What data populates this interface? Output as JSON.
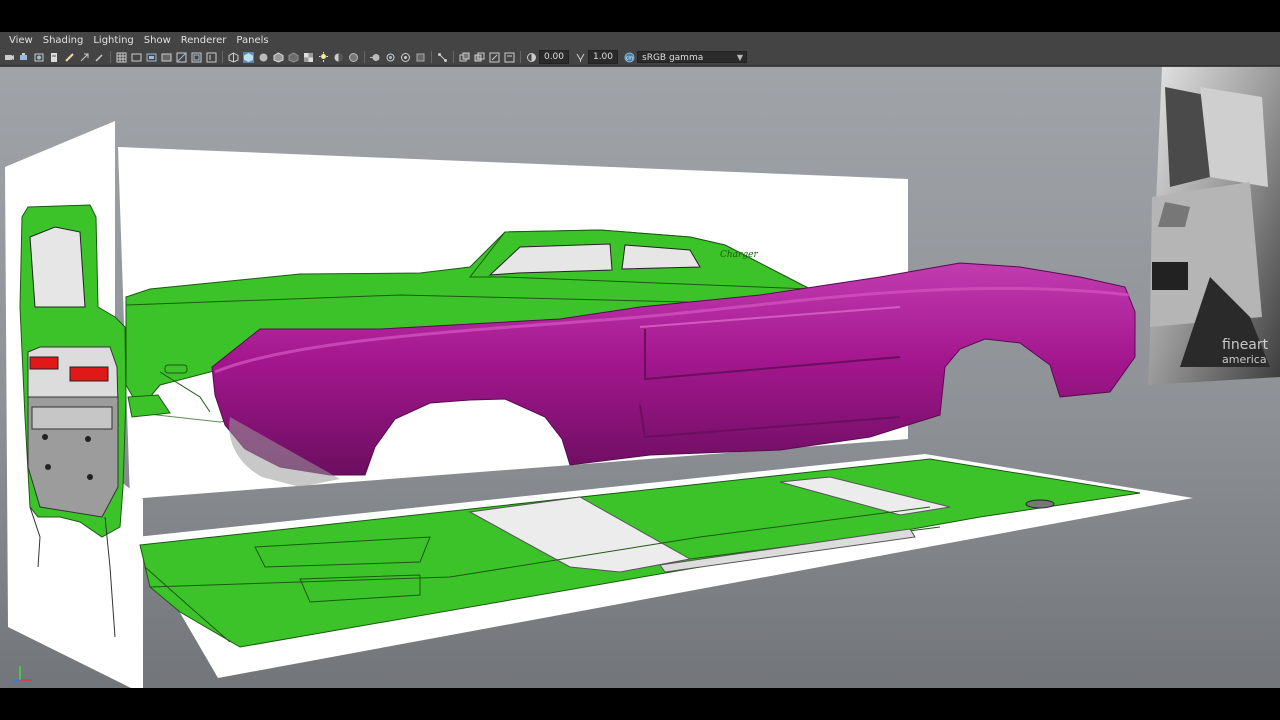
{
  "menu": {
    "items": [
      "View",
      "Shading",
      "Lighting",
      "Show",
      "Renderer",
      "Panels"
    ]
  },
  "toolbar": {
    "exposure_value": "0.00",
    "gamma_value": "1.00",
    "color_space": "sRGB gamma",
    "icons": [
      "camera-select-icon",
      "camera-attributes-icon",
      "bookmark-icon",
      "image-plane-icon",
      "grease-pencil-icon",
      "2d-pan-zoom-icon",
      "grid-icon",
      "film-gate-icon",
      "resolution-gate-icon",
      "gate-mask-icon",
      "field-chart-icon",
      "safe-action-icon",
      "safe-title-icon",
      "wireframe-icon",
      "smooth-shade-icon",
      "use-default-material-icon",
      "wireframe-on-shaded-icon",
      "xray-icon",
      "textured-icon",
      "lights-icon",
      "shadows-icon",
      "ambient-occlusion-icon",
      "motion-blur-icon",
      "multisample-aa-icon",
      "depth-of-field-icon",
      "isolate-select-icon",
      "xray-joints-icon",
      "xray-active-components-icon",
      "exposure-icon",
      "gamma-icon",
      "color-management-icon"
    ]
  },
  "colors": {
    "blueprint_green": "#3dc32a",
    "body_magenta": "#a4178f",
    "viewport_top": "#a0a4a9",
    "viewport_bottom": "#727579"
  },
  "reference": {
    "watermark_line1": "fineart",
    "watermark_line2": "america"
  }
}
